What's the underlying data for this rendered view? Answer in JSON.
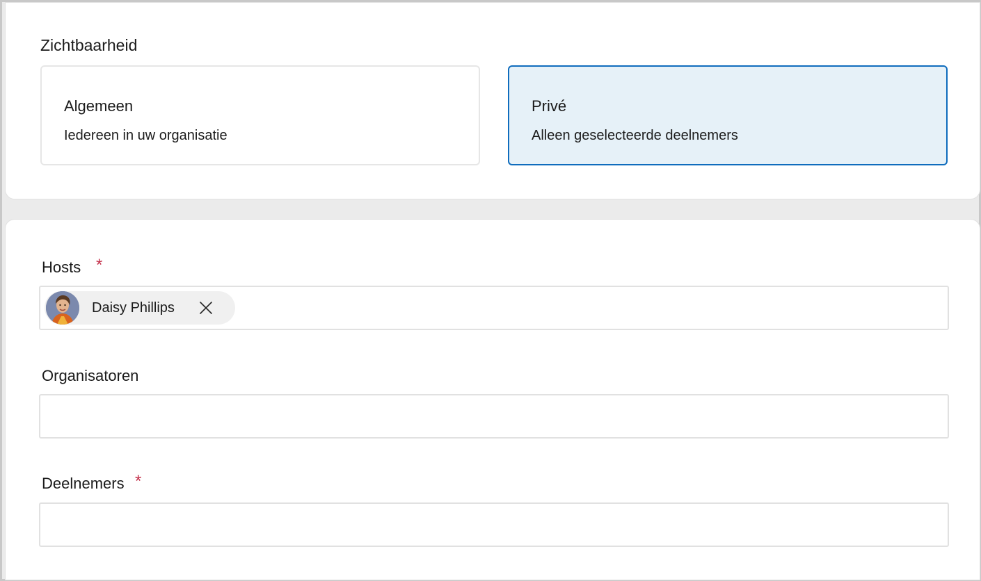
{
  "visibility": {
    "title": "Zichtbaarheid",
    "options": [
      {
        "title": "Algemeen",
        "description": "Iedereen in uw organisatie",
        "selected": false
      },
      {
        "title": "Privé",
        "description": "Alleen geselecteerde deelnemers",
        "selected": true
      }
    ]
  },
  "hosts": {
    "label": "Hosts",
    "required_marker": "*",
    "chips": [
      {
        "name": "Daisy Phillips",
        "avatar_icon": "person-photo-icon",
        "remove_icon": "close-icon"
      }
    ]
  },
  "organizers": {
    "label": "Organisatoren",
    "value": ""
  },
  "participants": {
    "label": "Deelnemers",
    "required_marker": "*",
    "value": ""
  },
  "colors": {
    "accent": "#0f6cbd",
    "selected_background": "#e6f1f8",
    "required": "#c4314b"
  }
}
